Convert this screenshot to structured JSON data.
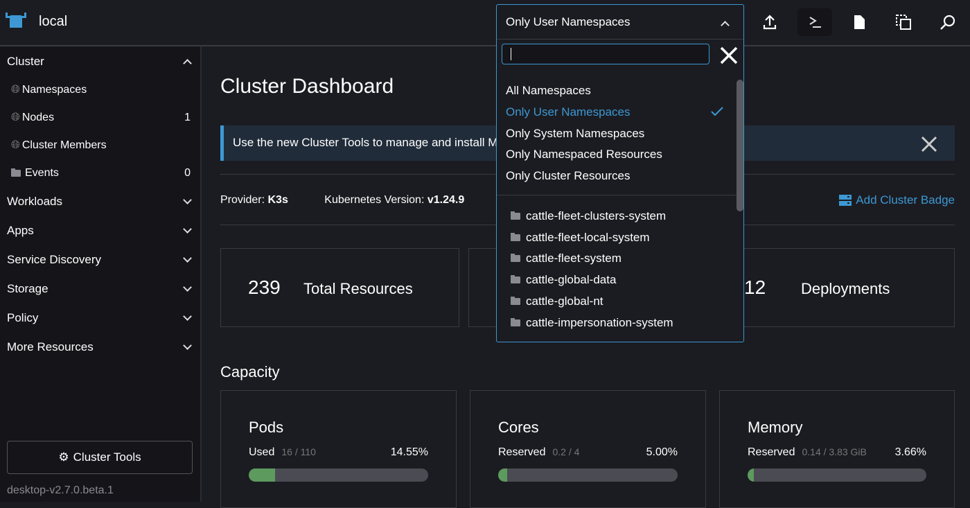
{
  "header": {
    "cluster": "local",
    "icons": [
      "upload-icon",
      "terminal-icon",
      "file-icon",
      "copy-icon",
      "search-icon"
    ]
  },
  "namespace_filter": {
    "selected": "Only User Namespaces",
    "search_value": "",
    "options": [
      "All Namespaces",
      "Only User Namespaces",
      "Only System Namespaces",
      "Only Namespaced Resources",
      "Only Cluster Resources"
    ],
    "namespaces": [
      "cattle-fleet-clusters-system",
      "cattle-fleet-local-system",
      "cattle-fleet-system",
      "cattle-global-data",
      "cattle-global-nt",
      "cattle-impersonation-system"
    ]
  },
  "sidebar": {
    "cluster_label": "Cluster",
    "items": [
      {
        "label": "Namespaces",
        "count": ""
      },
      {
        "label": "Nodes",
        "count": "1"
      },
      {
        "label": "Cluster Members",
        "count": ""
      },
      {
        "label": "Events",
        "count": "0"
      }
    ],
    "groups": [
      "Workloads",
      "Apps",
      "Service Discovery",
      "Storage",
      "Policy",
      "More Resources"
    ],
    "tools": "Cluster Tools",
    "version": "desktop-v2.7.0.beta.1"
  },
  "main": {
    "title": "Cluster Dashboard",
    "banner": "Use the new Cluster Tools to manage and install Monitoring, Logging and more.",
    "provider_label": "Provider:",
    "provider": "K3s",
    "k8s_label": "Kubernetes Version:",
    "k8s": "v1.24.9",
    "badge": "Add Cluster Badge",
    "summary": [
      {
        "count": "239",
        "label": "Total Resources"
      },
      {
        "count": "12",
        "label": "Deployments"
      }
    ],
    "capacity_title": "Capacity",
    "capacity": [
      {
        "title": "Pods",
        "label": "Used",
        "sub": "16 / 110",
        "pct": "14.55%",
        "fraction": 0.1455
      },
      {
        "title": "Cores",
        "label": "Reserved",
        "sub": "0.2 / 4",
        "pct": "5.00%",
        "fraction": 0.05
      },
      {
        "title": "Memory",
        "label": "Reserved",
        "sub": "0.14 / 3.83 GiB",
        "pct": "3.66%",
        "fraction": 0.0366
      }
    ]
  },
  "colors": {
    "accent": "#3d98d3",
    "bar_fill": "#5d9a5e",
    "bar_track": "#4b4c53"
  }
}
